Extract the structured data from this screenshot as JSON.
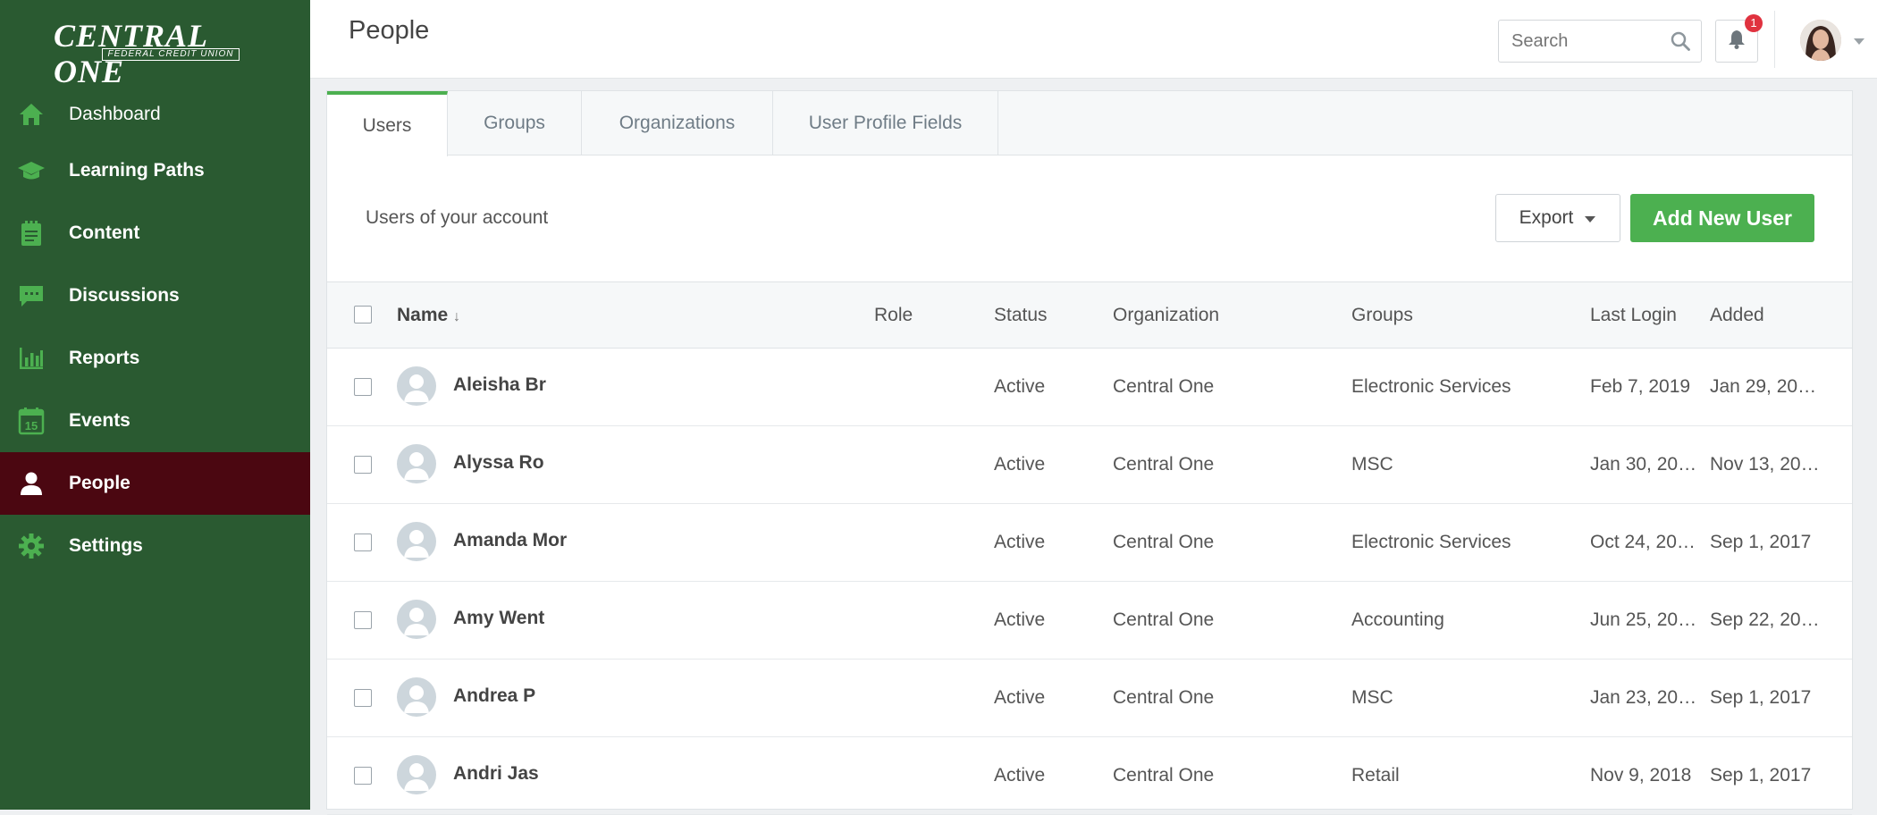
{
  "brand": {
    "logo_main": "CENTRAL ONE",
    "logo_sub": "FEDERAL CREDIT UNION"
  },
  "sidebar": {
    "items": [
      {
        "label": "Dashboard",
        "icon": "home-icon"
      },
      {
        "label": "Learning Paths",
        "icon": "graduation-cap-icon"
      },
      {
        "label": "Content",
        "icon": "notepad-icon"
      },
      {
        "label": "Discussions",
        "icon": "chat-bubble-icon"
      },
      {
        "label": "Reports",
        "icon": "bar-chart-icon"
      },
      {
        "label": "Events",
        "icon": "calendar-icon",
        "calendar_day": "15"
      },
      {
        "label": "People",
        "icon": "person-icon",
        "active": true
      },
      {
        "label": "Settings",
        "icon": "gear-icon"
      }
    ],
    "colors": {
      "background": "#2a5a31",
      "active": "#4b0711",
      "icon": "#4cb050"
    }
  },
  "header": {
    "title": "People",
    "search_placeholder": "Search",
    "notification_count": "1"
  },
  "tabs": [
    "Users",
    "Groups",
    "Organizations",
    "User Profile Fields"
  ],
  "main": {
    "subtitle": "Users of your account",
    "export_label": "Export",
    "add_label": "Add New User",
    "accent": "#4cb050"
  },
  "table": {
    "columns": {
      "name": "Name",
      "sort_indicator": "↓",
      "role": "Role",
      "status": "Status",
      "organization": "Organization",
      "groups": "Groups",
      "last_login": "Last Login",
      "added": "Added"
    },
    "rows": [
      {
        "name": "Aleisha Br",
        "role": "",
        "status": "Active",
        "organization": "Central One",
        "groups": "Electronic Services",
        "last_login": "Feb 7, 2019",
        "added": "Jan 29, 20…"
      },
      {
        "name": "Alyssa Ro",
        "role": "",
        "status": "Active",
        "organization": "Central One",
        "groups": "MSC",
        "last_login": "Jan 30, 20…",
        "added": "Nov 13, 20…"
      },
      {
        "name": "Amanda Mor",
        "role": "",
        "status": "Active",
        "organization": "Central One",
        "groups": "Electronic Services",
        "last_login": "Oct 24, 20…",
        "added": "Sep 1, 2017"
      },
      {
        "name": "Amy Went",
        "role": "",
        "status": "Active",
        "organization": "Central One",
        "groups": "Accounting",
        "last_login": "Jun 25, 20…",
        "added": "Sep 22, 20…"
      },
      {
        "name": "Andrea P",
        "role": "",
        "status": "Active",
        "organization": "Central One",
        "groups": "MSC",
        "last_login": "Jan 23, 20…",
        "added": "Sep 1, 2017"
      },
      {
        "name": "Andri Jas",
        "role": "",
        "status": "Active",
        "organization": "Central One",
        "groups": "Retail",
        "last_login": "Nov 9, 2018",
        "added": "Sep 1, 2017"
      }
    ]
  }
}
